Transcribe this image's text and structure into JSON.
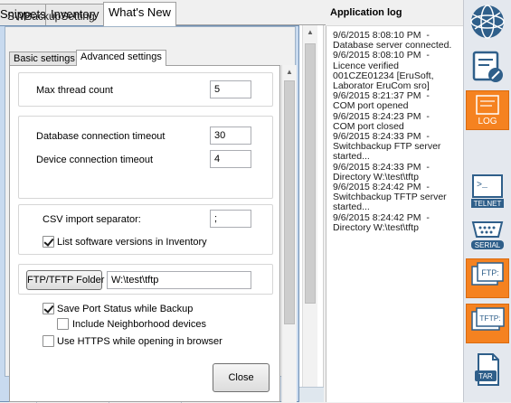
{
  "main_tabs": [
    "Snippets",
    "Inventory",
    "What's New"
  ],
  "dialog": {
    "title": "SWBackupSetting",
    "tabs": [
      "Basic settings",
      "Advanced settings"
    ],
    "max_thread_label": "Max thread count",
    "max_thread_value": "5",
    "db_timeout_label": "Database connection timeout",
    "db_timeout_value": "30",
    "device_timeout_label": "Device connection timeout",
    "device_timeout_value": "4",
    "csv_label": "CSV import separator:",
    "csv_value": ";",
    "list_sw_label": "List software versions in Inventory",
    "list_sw_checked": true,
    "folder_button": "FTP/TFTP Folder",
    "folder_value": "W:\\test\\tftp",
    "save_port_label": "Save Port Status while Backup",
    "save_port_checked": true,
    "include_neighbor_label": "Include Neighborhood devices",
    "include_neighbor_checked": false,
    "use_https_label": "Use HTTPS while opening in browser",
    "use_https_checked": false,
    "close_button": "Close"
  },
  "log": {
    "title": "Application log",
    "lines": [
      "9/6/2015 8:08:10 PM  -\nDatabase server connected.",
      "9/6/2015 8:08:10 PM  -\nLicence verified\n001CZE01234 [EruSoft,\nLaborator EruCom sro]",
      "9/6/2015 8:21:37 PM  -\nCOM port opened",
      "9/6/2015 8:24:23 PM  -\nCOM port closed",
      "9/6/2015 8:24:33 PM  -\nSwitchbackup FTP server\nstarted...",
      "9/6/2015 8:24:33 PM  -\nDirectory W:\\test\\tftp",
      "9/6/2015 8:24:42 PM  -\nSwitchbackup TFTP server\nstarted...",
      "9/6/2015 8:24:42 PM  -\nDirectory W:\\test\\tftp"
    ]
  },
  "toolbar": {
    "log_label": "LOG",
    "telnet_label": "TELNET",
    "serial_label": "SERIAL",
    "ftp_label": "FTP:",
    "tftp_label": "TFTP:",
    "tar_label": "TAR",
    "icons": [
      "network-globe-icon",
      "settings-edit-icon",
      "log-icon",
      "telnet-icon",
      "serial-icon",
      "ftp-icon",
      "tftp-icon",
      "tar-archive-icon"
    ],
    "accent_color": "#2f5f8a",
    "highlight_color": "#f58220"
  }
}
